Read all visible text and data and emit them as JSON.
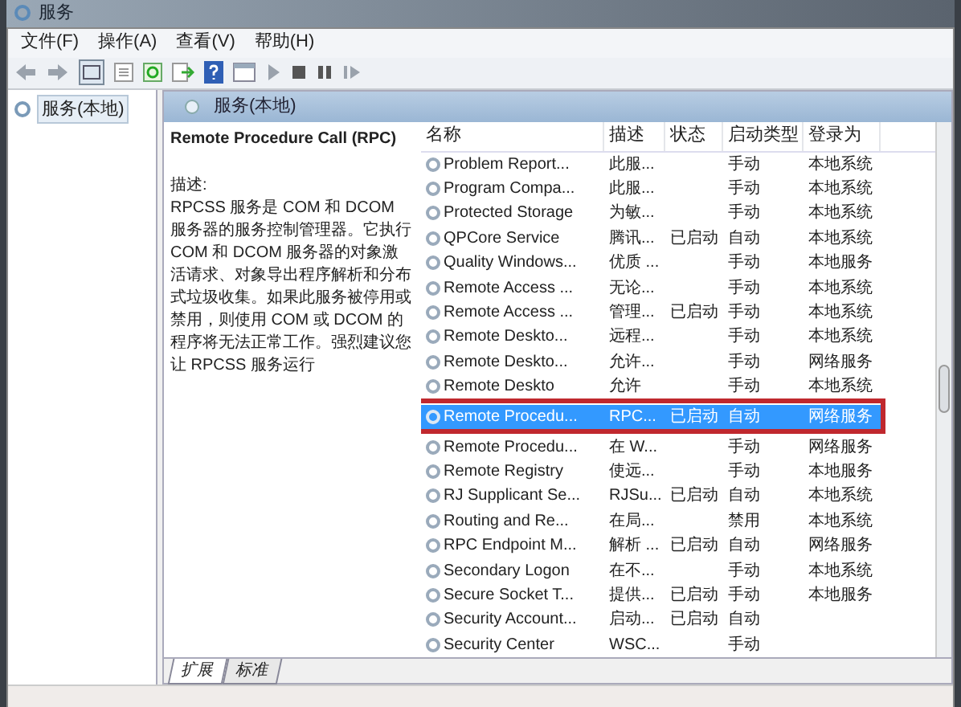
{
  "window": {
    "title": "服务"
  },
  "menu": [
    "文件(F)",
    "操作(A)",
    "查看(V)",
    "帮助(H)"
  ],
  "tree": {
    "items": [
      {
        "label": "服务(本地)",
        "selected": true
      }
    ]
  },
  "pane": {
    "title": "服务(本地)"
  },
  "details": {
    "service_name": "Remote Procedure Call (RPC)",
    "description_label": "描述:",
    "description": "RPCSS 服务是 COM 和 DCOM 服务器的服务控制管理器。它执行 COM 和 DCOM 服务器的对象激活请求、对象导出程序解析和分布式垃圾收集。如果此服务被停用或禁用，则使用 COM 或 DCOM 的程序将无法正常工作。强烈建议您让 RPCSS 服务运行"
  },
  "table": {
    "columns": [
      "名称",
      "描述",
      "状态",
      "启动类型",
      "登录为"
    ],
    "rows": [
      {
        "cells": [
          "Problem Report...",
          "此服...",
          "",
          "手动",
          "本地系统"
        ],
        "selected": false
      },
      {
        "cells": [
          "Program Compa...",
          "此服...",
          "",
          "手动",
          "本地系统"
        ],
        "selected": false
      },
      {
        "cells": [
          "Protected Storage",
          "为敏...",
          "",
          "手动",
          "本地系统"
        ],
        "selected": false
      },
      {
        "cells": [
          "QPCore Service",
          "腾讯...",
          "已启动",
          "自动",
          "本地系统"
        ],
        "selected": false
      },
      {
        "cells": [
          "Quality Windows...",
          "优质 ...",
          "",
          "手动",
          "本地服务"
        ],
        "selected": false
      },
      {
        "cells": [
          "Remote Access ...",
          "无论...",
          "",
          "手动",
          "本地系统"
        ],
        "selected": false
      },
      {
        "cells": [
          "Remote Access ...",
          "管理...",
          "已启动",
          "手动",
          "本地系统"
        ],
        "selected": false
      },
      {
        "cells": [
          "Remote Deskto...",
          "远程...",
          "",
          "手动",
          "本地系统"
        ],
        "selected": false
      },
      {
        "cells": [
          "Remote Deskto...",
          "允许...",
          "",
          "手动",
          "网络服务"
        ],
        "selected": false
      },
      {
        "cells": [
          "Remote Deskto",
          "允许",
          "",
          "手动",
          "本地系统"
        ],
        "selected": false
      },
      {
        "cells": [
          "Remote Procedu...",
          "RPC...",
          "已启动",
          "自动",
          "网络服务"
        ],
        "selected": true
      },
      {
        "cells": [
          "Remote Procedu...",
          "在 W...",
          "",
          "手动",
          "网络服务"
        ],
        "selected": false
      },
      {
        "cells": [
          "Remote Registry",
          "使远...",
          "",
          "手动",
          "本地服务"
        ],
        "selected": false
      },
      {
        "cells": [
          "RJ Supplicant Se...",
          "RJSu...",
          "已启动",
          "自动",
          "本地系统"
        ],
        "selected": false
      },
      {
        "cells": [
          "Routing and Re...",
          "在局...",
          "",
          "禁用",
          "本地系统"
        ],
        "selected": false
      },
      {
        "cells": [
          "RPC Endpoint M...",
          "解析 ...",
          "已启动",
          "自动",
          "网络服务"
        ],
        "selected": false
      },
      {
        "cells": [
          "Secondary Logon",
          "在不...",
          "",
          "手动",
          "本地系统"
        ],
        "selected": false
      },
      {
        "cells": [
          "Secure Socket T...",
          "提供...",
          "已启动",
          "手动",
          "本地服务"
        ],
        "selected": false
      },
      {
        "cells": [
          "Security Account...",
          "启动...",
          "已启动",
          "自动",
          ""
        ],
        "selected": false
      },
      {
        "cells": [
          "Security Center",
          "WSC...",
          "",
          "手动",
          ""
        ],
        "selected": false
      }
    ]
  },
  "tabs": [
    {
      "label": "扩展",
      "selected": true
    },
    {
      "label": "标准",
      "selected": false
    }
  ]
}
